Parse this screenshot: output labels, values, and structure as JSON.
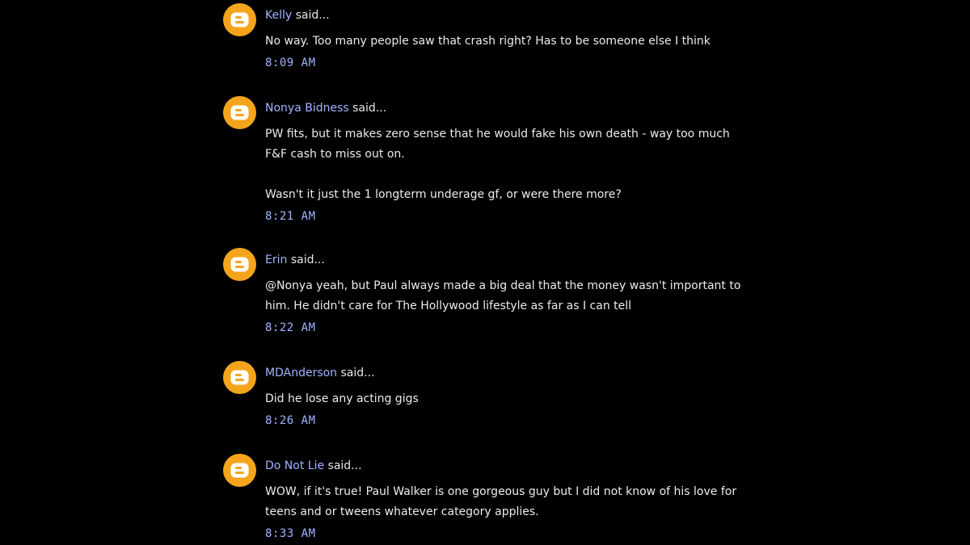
{
  "colors": {
    "background": "#000000",
    "link": "#a0b4ff",
    "text": "#ececec",
    "avatar": "#f4a51c"
  },
  "comments": [
    {
      "author": "Kelly",
      "said": "said...",
      "avatar_icon": "blogger-icon",
      "paragraphs": [
        "No way. Too many people saw that crash right? Has to be someone else I think"
      ],
      "time": "8:09 AM"
    },
    {
      "author": "Nonya Bidness",
      "said": "said...",
      "avatar_icon": "blogger-icon",
      "paragraphs": [
        "PW fits, but it makes zero sense that he would fake his own death - way too much F&F cash to miss out on.",
        "",
        "Wasn't it just the 1 longterm underage gf, or were there more?"
      ],
      "time": "8:21 AM"
    },
    {
      "author": "Erin",
      "said": "said...",
      "avatar_icon": "blogger-icon",
      "paragraphs": [
        "@Nonya yeah, but Paul always made a big deal that the money wasn't important to him. He didn't care for The Hollywood lifestyle as far as I can tell"
      ],
      "time": "8:22 AM"
    },
    {
      "author": "MDAnderson",
      "said": "said...",
      "avatar_icon": "blogger-icon",
      "paragraphs": [
        "Did he lose any acting gigs"
      ],
      "time": "8:26 AM"
    },
    {
      "author": "Do Not Lie",
      "said": "said...",
      "avatar_icon": "blogger-icon",
      "paragraphs": [
        "WOW, if it's true! Paul Walker is one gorgeous guy but I did not know of his love for teens and or tweens whatever category applies."
      ],
      "time": "8:33 AM"
    }
  ]
}
